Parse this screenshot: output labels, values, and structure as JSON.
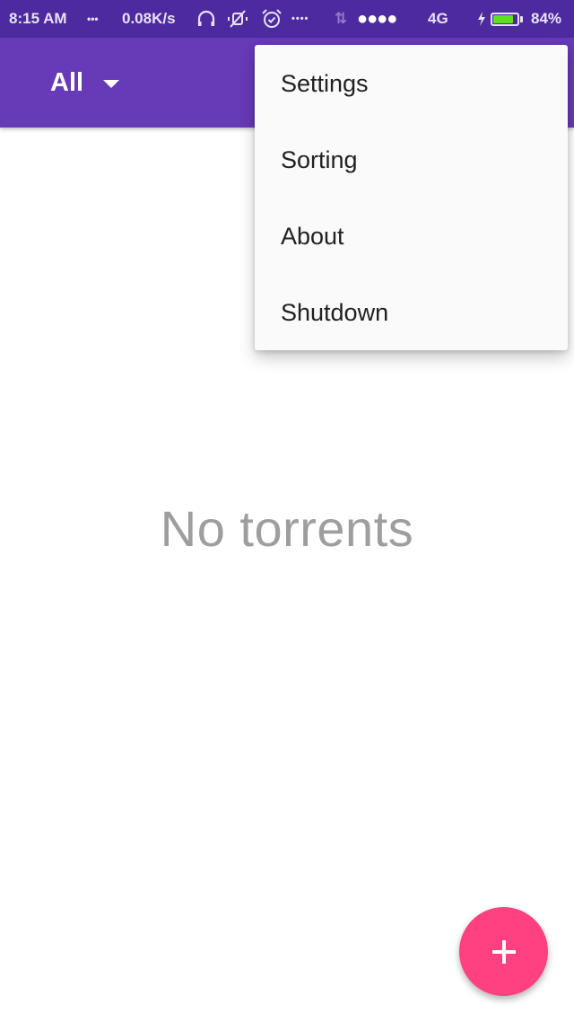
{
  "status_bar": {
    "time": "8:15 AM",
    "more_dots": "•••",
    "net_speed": "0.08K/s",
    "icons": [
      "headphones-icon",
      "vibrate-off-icon",
      "alarm-icon"
    ],
    "sim_dots": "••••",
    "data_arrows": "⇅",
    "signal": "●●●●",
    "network_type": "4G",
    "charging_bolt": "⚡",
    "battery_percent": "84%",
    "battery_level": 0.84,
    "battery_color": "#5ee01e"
  },
  "app_bar": {
    "filter_label": "All",
    "color": "#673ab7"
  },
  "overflow_menu": {
    "items": [
      {
        "label": "Settings"
      },
      {
        "label": "Sorting"
      },
      {
        "label": "About"
      },
      {
        "label": "Shutdown"
      }
    ]
  },
  "main": {
    "empty_text": "No torrents"
  },
  "fab": {
    "icon": "plus-icon",
    "color": "#ff4081"
  }
}
